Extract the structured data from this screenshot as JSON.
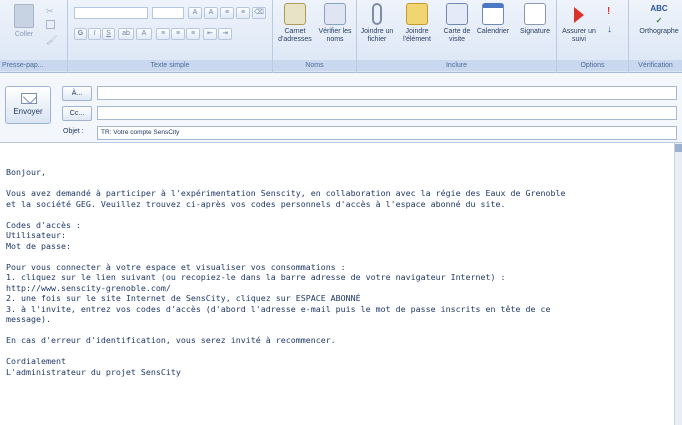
{
  "ribbon": {
    "clipboard": {
      "paste_label": "Coller",
      "group_label": "Presse-pap..."
    },
    "basic_text": {
      "font_name": "",
      "font_size": "",
      "bold": "G",
      "italic": "I",
      "underline": "S",
      "group_label": "Texte simple"
    },
    "names": {
      "address_book_label": "Carnet d'adresses",
      "check_names_label": "Vérifier les noms",
      "group_label": "Noms"
    },
    "include": {
      "attach_file_label": "Joindre un fichier",
      "attach_item_label": "Joindre l'élément",
      "business_card_label": "Carte de visite",
      "calendar_label": "Calendrier",
      "signature_label": "Signature",
      "group_label": "Inclure"
    },
    "options": {
      "follow_up_label": "Assurer un suivi",
      "group_label": "Options"
    },
    "proofing": {
      "spelling_label": "Orthographe",
      "group_label": "Vérification"
    }
  },
  "header": {
    "send_label": "Envoyer",
    "to_label": "À...",
    "cc_label": "Cc...",
    "subject_label": "Objet :",
    "to_value": "",
    "cc_value": "",
    "subject_value": "TR: Votre compte SensCity"
  },
  "body": {
    "lines": [
      "Bonjour,",
      "",
      "Vous avez demandé à participer à l'expérimentation Senscity, en collaboration avec la régie des Eaux de Grenoble",
      "et la société GEG. Veuillez trouvez ci-après vos codes personnels d'accès à l'espace abonné du site.",
      "",
      "Codes d'accès :",
      "Utilisateur:",
      "Mot de passe:",
      "",
      "Pour vous connecter à votre espace et visualiser vos consommations :",
      "1. cliquez sur le lien suivant (ou recopiez-le dans la barre adresse de votre navigateur Internet) :",
      "http://www.senscity-grenoble.com/",
      "2. une fois sur le site Internet de SensCity, cliquez sur ESPACE ABONNÉ",
      "3. à l'invite, entrez vos codes d'accès (d'abord l'adresse e-mail puis le mot de passe inscrits en tête de ce",
      "message).",
      "",
      "En cas d'erreur d'identification, vous serez invité à recommencer.",
      "",
      "Cordialement",
      "L'administrateur du projet SensCity"
    ]
  },
  "colors": {
    "ribbon_bg": "#dbe6f5",
    "text": "#1f3864",
    "accent_flag": "#d9342b"
  }
}
